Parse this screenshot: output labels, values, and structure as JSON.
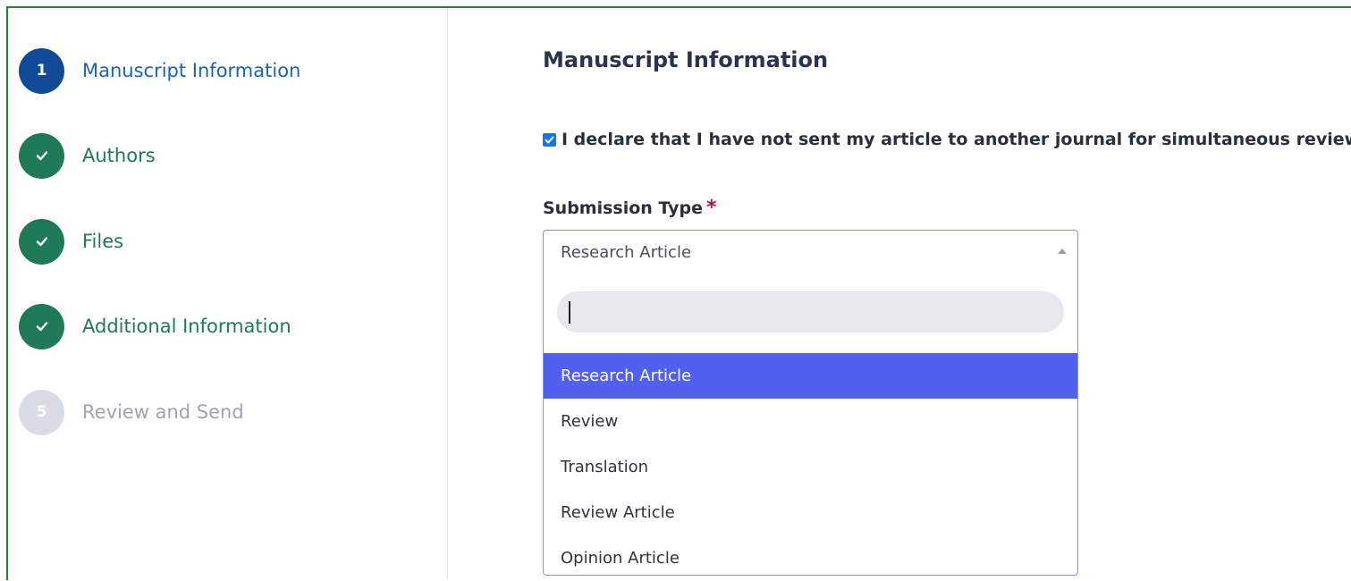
{
  "steps": [
    {
      "number": "1",
      "label": "Manuscript Information",
      "state": "active"
    },
    {
      "number": "",
      "label": "Authors",
      "state": "done"
    },
    {
      "number": "",
      "label": "Files",
      "state": "done"
    },
    {
      "number": "",
      "label": "Additional Information",
      "state": "done"
    },
    {
      "number": "5",
      "label": "Review and Send",
      "state": "pending"
    }
  ],
  "main": {
    "title": "Manuscript Information",
    "declaration": {
      "checked": true,
      "text": "I declare that I have not sent my article to another journal for simultaneous review."
    },
    "submission_type": {
      "label": "Submission Type",
      "required_mark": "*",
      "selected": "Research Article",
      "search_value": "",
      "options": [
        "Research Article",
        "Review",
        "Translation",
        "Review Article",
        "Opinion Article"
      ]
    }
  },
  "colors": {
    "frame_border": "#2e7d32",
    "active_step": "#114a96",
    "done_step": "#1f7a57",
    "pending_step": "#d9dbe6",
    "selected_option": "#5260ef",
    "required": "#b0124e"
  },
  "icons": {
    "done_step_icon": "checkmark-icon",
    "dropdown_arrow": "caret-up-icon",
    "checkbox": "checkbox-checked-icon"
  }
}
